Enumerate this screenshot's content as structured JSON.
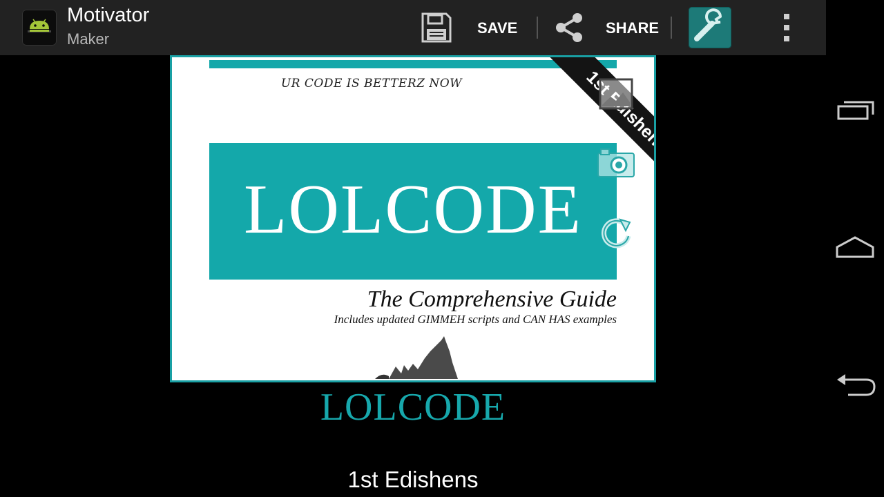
{
  "app": {
    "title": "Motivator",
    "subtitle": "Maker"
  },
  "actions": {
    "save_label": "SAVE",
    "share_label": "SHARE"
  },
  "icons": {
    "app": "android-icon",
    "save": "floppy-disk-icon",
    "share": "share-icon",
    "settings": "wrench-icon",
    "overflow": "overflow-menu-icon",
    "gallery": "gallery-icon",
    "camera": "camera-icon",
    "rotate": "rotate-icon",
    "recents": "recent-apps-icon",
    "home": "home-icon",
    "back": "back-icon"
  },
  "poster": {
    "tagline": "UR CODE IS BETTERZ NOW",
    "block_title": "LOLCODE",
    "guide_title": "The Comprehensive Guide",
    "guide_subtitle": "Includes updated GIMMEH scripts and CAN HAS examples",
    "ribbon": "1st Edishens"
  },
  "caption": {
    "title": "LOLCODE",
    "subtitle": "1st Edishens"
  },
  "colors": {
    "accent": "#19a0a4",
    "actionbar": "#222222",
    "selected_action": "#1d7a78"
  }
}
